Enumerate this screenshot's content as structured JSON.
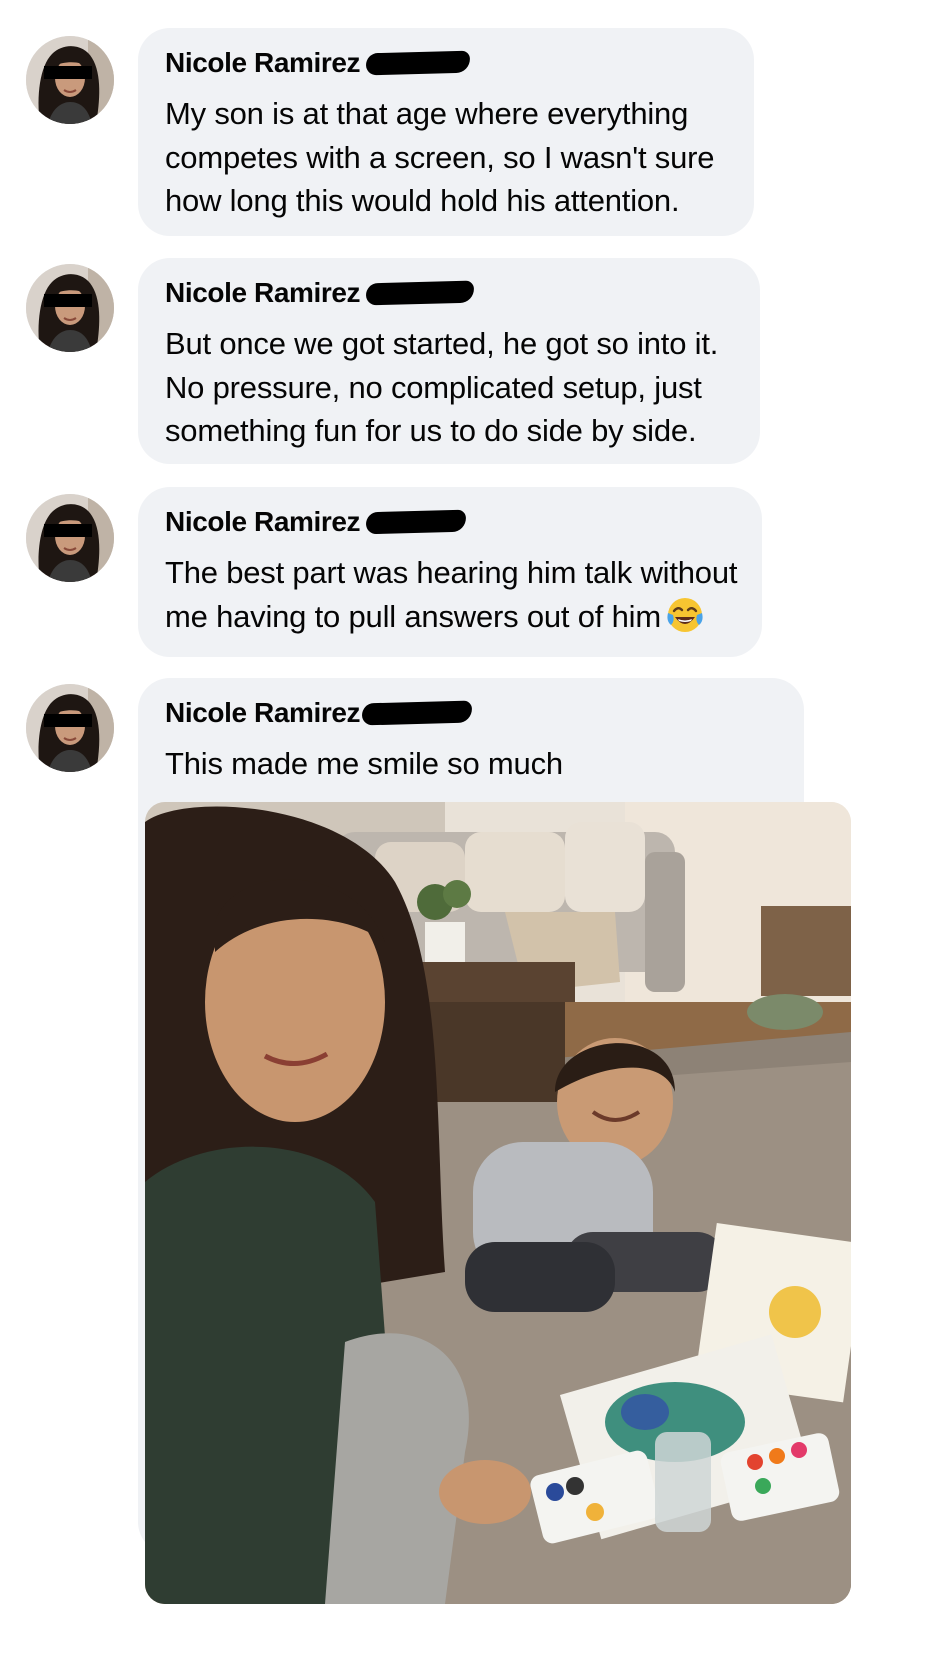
{
  "comments": [
    {
      "author": "Nicole Ramirez",
      "text_lines": [
        "My son is at that age where everything",
        "competes with a screen, so I wasn't sure",
        "how long this would hold his attention."
      ]
    },
    {
      "author": "Nicole Ramirez",
      "text_lines": [
        "But once we got started, he got so into it.",
        "No pressure, no complicated setup, just",
        "something fun for us to do side by side."
      ]
    },
    {
      "author": "Nicole Ramirez",
      "text_lines": [
        "The best part was hearing him talk without",
        "me having to pull answers out of him"
      ],
      "emoji": "tears-of-joy"
    },
    {
      "author": "Nicole Ramirez",
      "text_lines": [
        "This made me smile so much"
      ],
      "has_photo": true
    }
  ],
  "colors": {
    "bubble": "#f0f2f5",
    "text": "#050505",
    "redaction": "#000000"
  }
}
